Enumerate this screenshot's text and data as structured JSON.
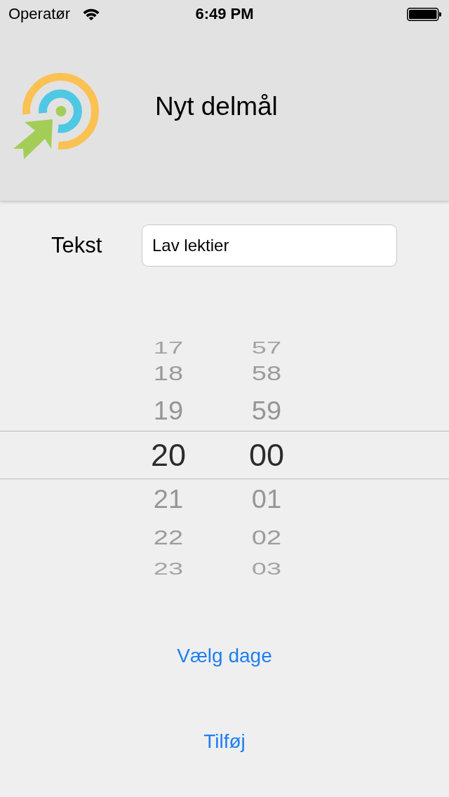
{
  "status_bar": {
    "carrier": "Operatør",
    "time": "6:49 PM"
  },
  "header": {
    "title": "Nyt delmål"
  },
  "form": {
    "label": "Tekst",
    "value": "Lav lektier"
  },
  "time_picker": {
    "columns": [
      {
        "items": [
          {
            "value": "17",
            "selected": false
          },
          {
            "value": "18",
            "selected": false
          },
          {
            "value": "19",
            "selected": false
          },
          {
            "value": "20",
            "selected": true
          },
          {
            "value": "21",
            "selected": false
          },
          {
            "value": "22",
            "selected": false
          },
          {
            "value": "23",
            "selected": false
          }
        ]
      },
      {
        "items": [
          {
            "value": "57",
            "selected": false
          },
          {
            "value": "58",
            "selected": false
          },
          {
            "value": "59",
            "selected": false
          },
          {
            "value": "00",
            "selected": true
          },
          {
            "value": "01",
            "selected": false
          },
          {
            "value": "02",
            "selected": false
          },
          {
            "value": "03",
            "selected": false
          }
        ]
      }
    ]
  },
  "buttons": [
    {
      "label": "Vælg dage"
    },
    {
      "label": "Tilføj"
    }
  ]
}
